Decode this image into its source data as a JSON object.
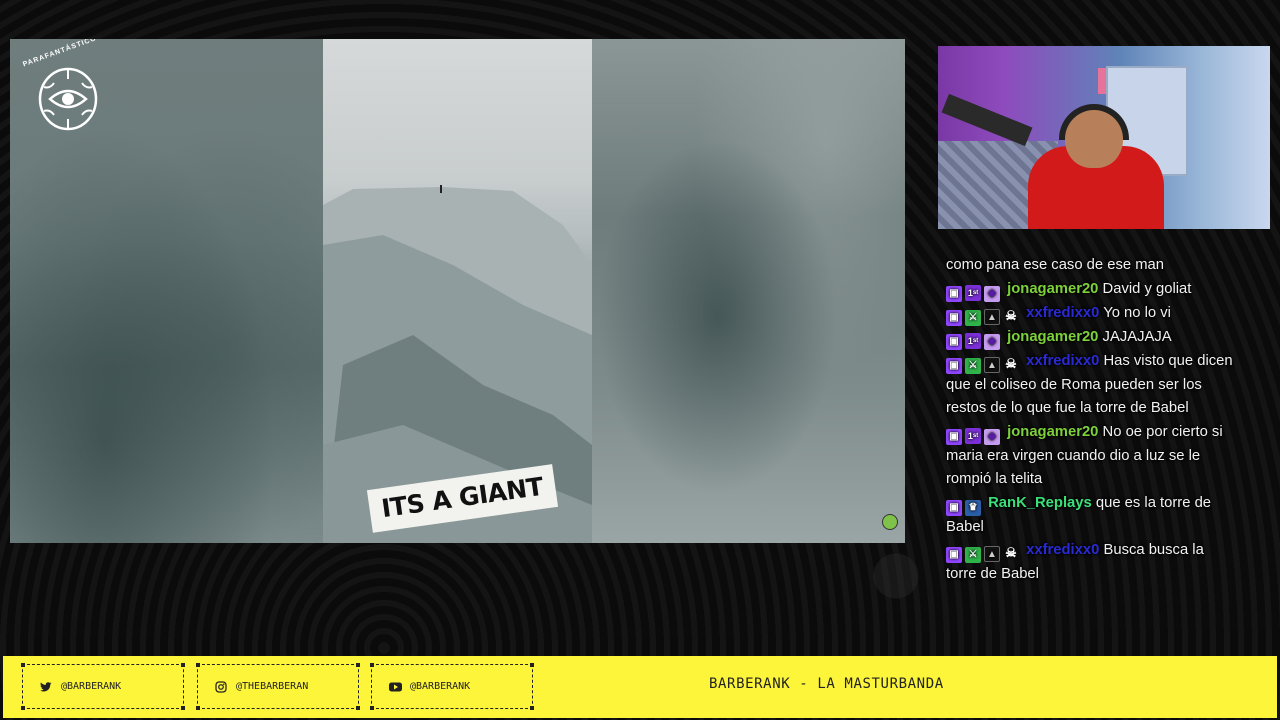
{
  "video": {
    "brand_text": "PARAFANTÁSTICO",
    "caption": "ITS A GIANT"
  },
  "chat": {
    "messages": [
      {
        "badges": [],
        "user": "",
        "text": "como pana ese caso de ese man"
      },
      {
        "badges": [
          "sub-badge",
          "first-badge",
          "bits-badge"
        ],
        "user": "jonagamer20",
        "user_color": "#7dd13b",
        "text": "David y goliat"
      },
      {
        "badges": [
          "sub-badge",
          "sword-badge",
          "bat-badge",
          "skull-badge"
        ],
        "user": "xxfredixx0",
        "user_color": "#2a2ad6",
        "text": "Yo no lo vi"
      },
      {
        "badges": [
          "sub-badge",
          "first-badge",
          "bits-badge"
        ],
        "user": "jonagamer20",
        "user_color": "#7dd13b",
        "text": "JAJAJAJA"
      },
      {
        "badges": [
          "sub-badge",
          "sword-badge",
          "bat-badge",
          "skull-badge"
        ],
        "user": "xxfredixx0",
        "user_color": "#2a2ad6",
        "text": "Has visto que dicen que el coliseo de Roma pueden ser los restos de lo que fue la torre de Babel"
      },
      {
        "badges": [
          "sub-badge",
          "first-badge",
          "bits-badge"
        ],
        "user": "jonagamer20",
        "user_color": "#7dd13b",
        "text": "No oe por cierto si maria era virgen cuando dio a luz se le rompió la telita"
      },
      {
        "badges": [
          "sub-badge",
          "crown-badge"
        ],
        "user": "RanK_Replays",
        "user_color": "#3be07a",
        "text": "que es la torre de Babel"
      },
      {
        "badges": [
          "sub-badge",
          "sword-badge",
          "bat-badge",
          "skull-badge"
        ],
        "user": "xxfredixx0",
        "user_color": "#2a2ad6",
        "text": "Busca busca la torre de Babel"
      }
    ]
  },
  "footer": {
    "twitter": "@BARBERANK",
    "instagram": "@THEBARBERAN",
    "youtube": "@BARBERANK",
    "title": "BARBERANK - LA MASTURBANDA",
    "accent_color": "#fdf53a"
  }
}
